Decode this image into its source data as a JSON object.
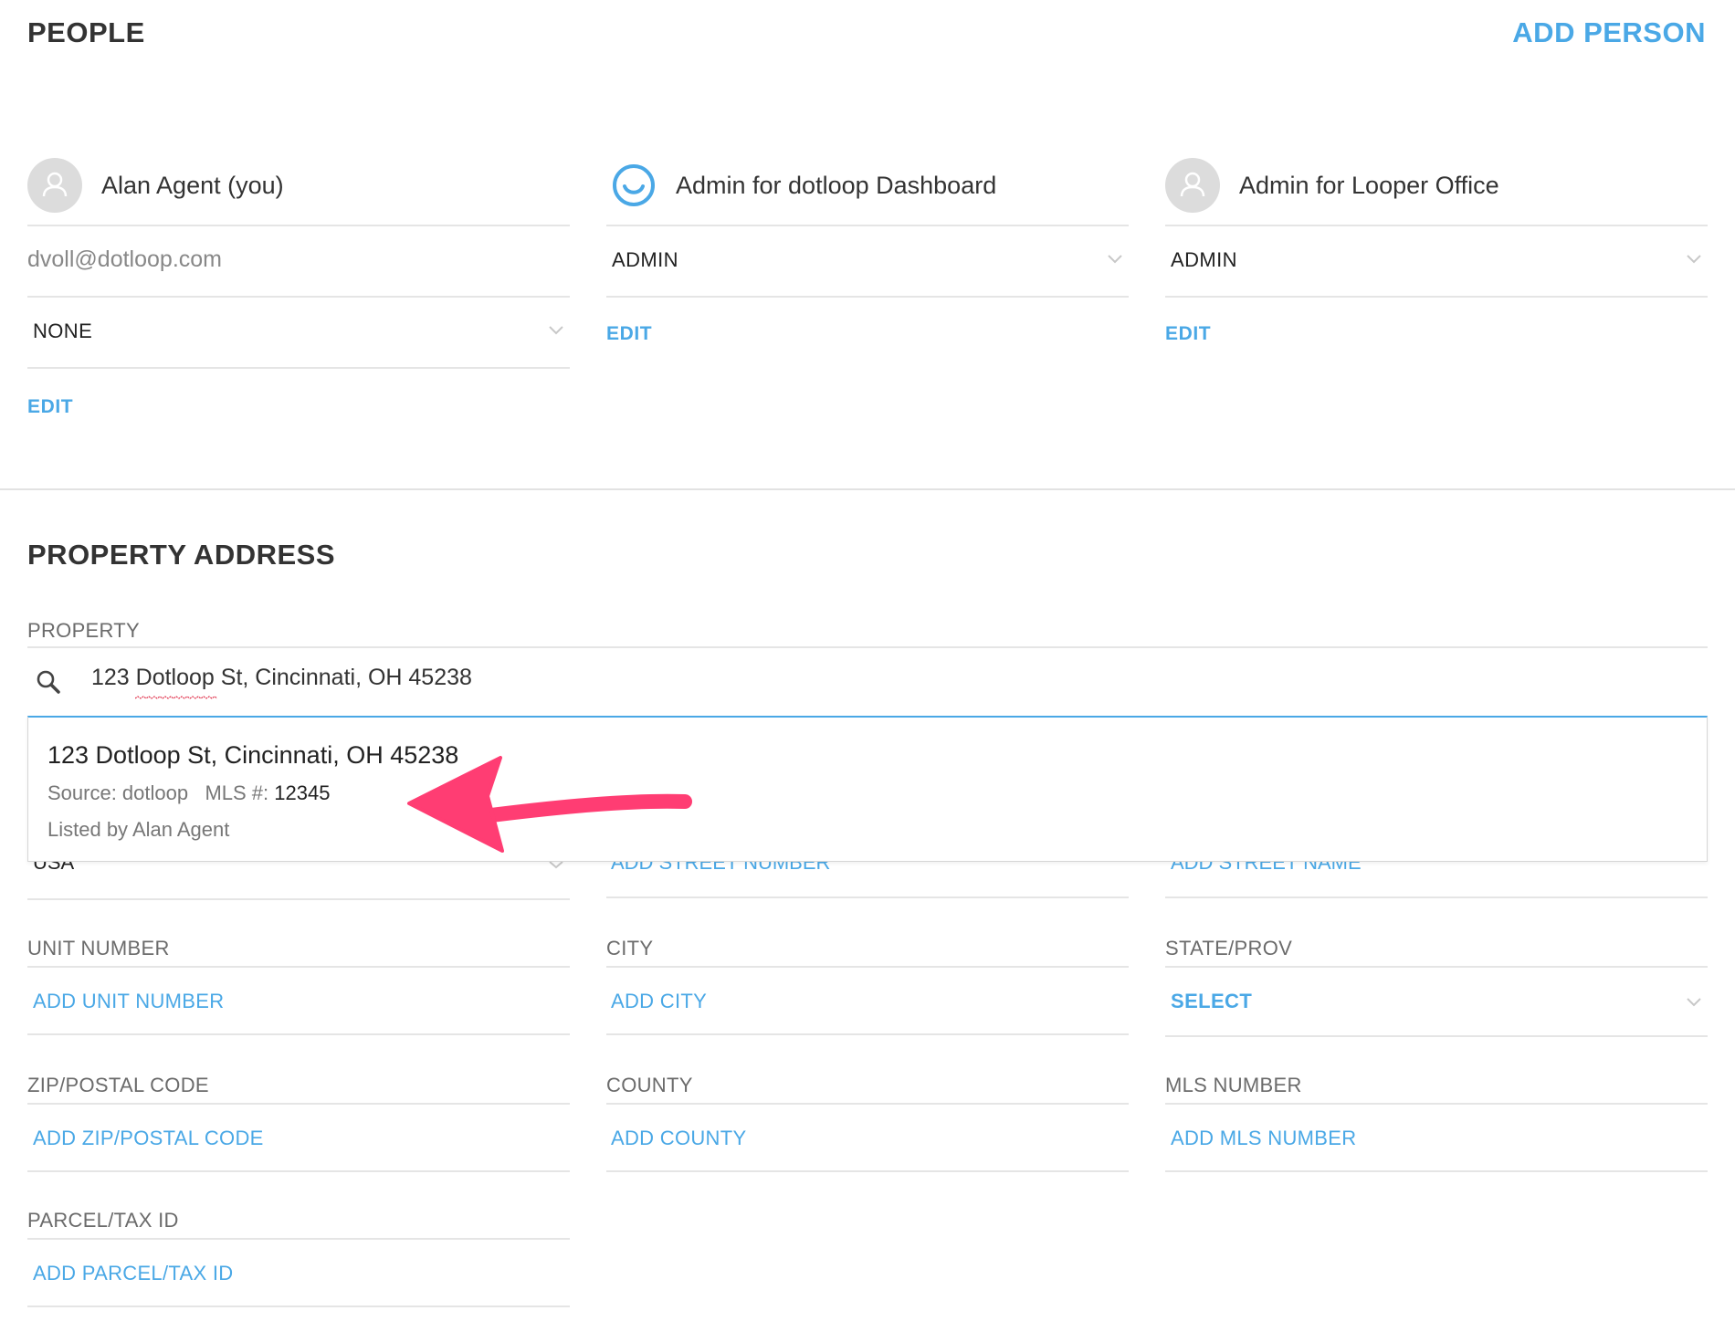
{
  "people": {
    "title": "PEOPLE",
    "add_person_label": "ADD PERSON",
    "persons": [
      {
        "name": "Alan Agent (you)",
        "email": "dvoll@dotloop.com",
        "role": "NONE",
        "edit_label": "EDIT",
        "avatar": "user-silhouette-icon"
      },
      {
        "name": "Admin for dotloop Dashboard",
        "role": "ADMIN",
        "edit_label": "EDIT",
        "avatar": "dotloop-logo-icon"
      },
      {
        "name": "Admin for Looper Office",
        "role": "ADMIN",
        "edit_label": "EDIT",
        "avatar": "user-silhouette-icon"
      }
    ]
  },
  "property": {
    "title": "PROPERTY ADDRESS",
    "property_label": "PROPERTY",
    "search_value": "123 Dotloop St, Cincinnati, OH 45238",
    "suggestion": {
      "title": "123 Dotloop St, Cincinnati, OH 45238",
      "source_label": "Source: dotloop",
      "mls_label": "MLS #:",
      "mls_value": "12345",
      "listed_by": "Listed by Alan Agent"
    },
    "hidden_row": {
      "country": "USA",
      "street_number": "ADD STREET NUMBER",
      "street_name": "ADD STREET NAME"
    },
    "fields": {
      "unit_label": "UNIT NUMBER",
      "unit_add": "ADD UNIT NUMBER",
      "city_label": "CITY",
      "city_add": "ADD CITY",
      "state_label": "STATE/PROV",
      "state_select": "SELECT",
      "zip_label": "ZIP/POSTAL CODE",
      "zip_add": "ADD ZIP/POSTAL CODE",
      "county_label": "COUNTY",
      "county_add": "ADD COUNTY",
      "mls_label": "MLS NUMBER",
      "mls_add": "ADD MLS NUMBER",
      "parcel_label": "PARCEL/TAX ID",
      "parcel_add": "ADD PARCEL/TAX ID"
    }
  },
  "colors": {
    "accent": "#4aa8e6",
    "annotation_arrow": "#ff3d73",
    "text": "#333333",
    "muted": "#6b6b6b"
  }
}
